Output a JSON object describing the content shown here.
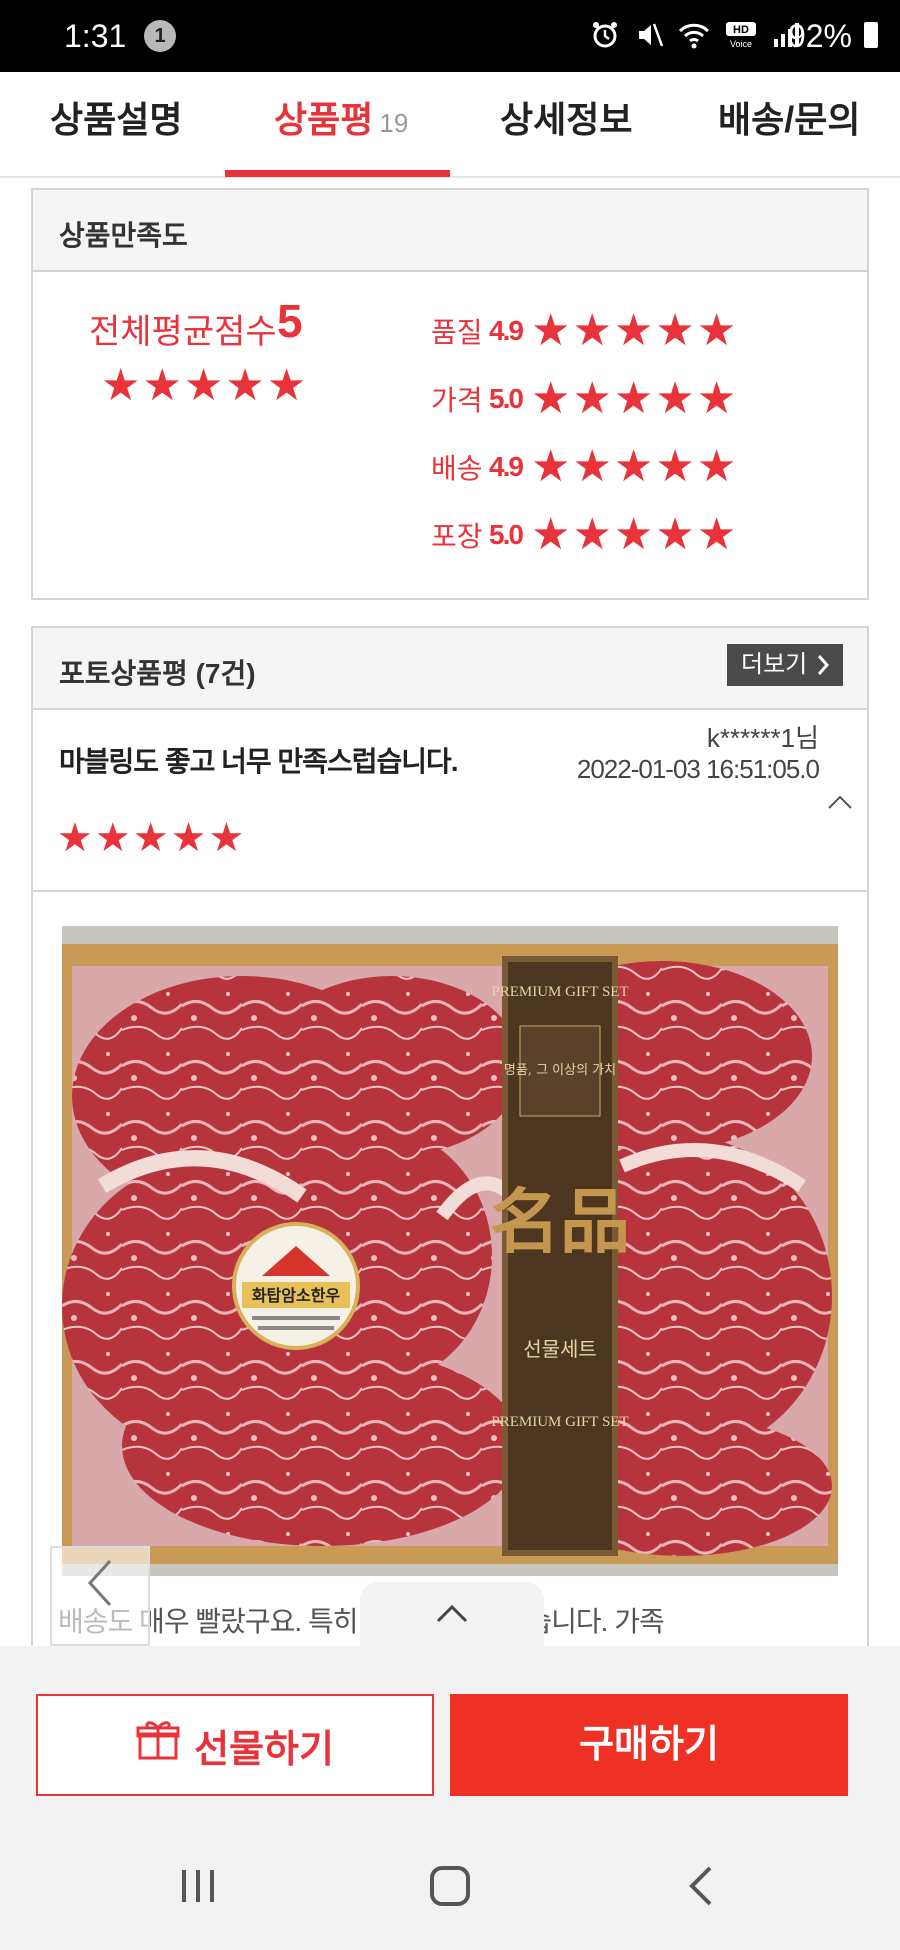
{
  "status_bar": {
    "time": "1:31",
    "notification_count": "1",
    "battery": "92%",
    "icons": [
      "alarm-icon",
      "mute-icon",
      "wifi-icon",
      "hd-voice-icon",
      "signal-icon",
      "battery-icon"
    ]
  },
  "tabs": [
    {
      "label": "상품설명",
      "active": false
    },
    {
      "label": "상품평",
      "count": "19",
      "active": true
    },
    {
      "label": "상세정보",
      "active": false
    },
    {
      "label": "배송/문의",
      "active": false
    }
  ],
  "satisfaction": {
    "title": "상품만족도",
    "overall_label": "전체평균점수",
    "overall_score": "5",
    "categories": [
      {
        "label": "품질",
        "score": "4.9"
      },
      {
        "label": "가격",
        "score": "5.0"
      },
      {
        "label": "배송",
        "score": "4.9"
      },
      {
        "label": "포장",
        "score": "5.0"
      }
    ]
  },
  "photo_reviews": {
    "title": "포토상품평 (7건)",
    "more_label": "더보기",
    "review": {
      "text": "마블링도 좋고 너무 만족스럽습니다.",
      "user": "k******1님",
      "date": "2022-01-03 16:51:05.0",
      "stars": 5,
      "caption": "배송도 매우 빨랐구요. 특히 너무 맘에 들었습니다. 가족"
    }
  },
  "photo_labels": {
    "box_top": "PREMIUM GIFT SET",
    "box_slogan": "명품, 그 이상의 가치",
    "box_main": "名品",
    "box_sub": "선물세트",
    "box_bottom": "PREMIUM GIFT SET",
    "sticker_title": "화탑암소한우"
  },
  "actions": {
    "gift_label": "선물하기",
    "buy_label": "구매하기"
  },
  "colors": {
    "accent": "#e8333a",
    "buy_button": "#ee3124"
  }
}
